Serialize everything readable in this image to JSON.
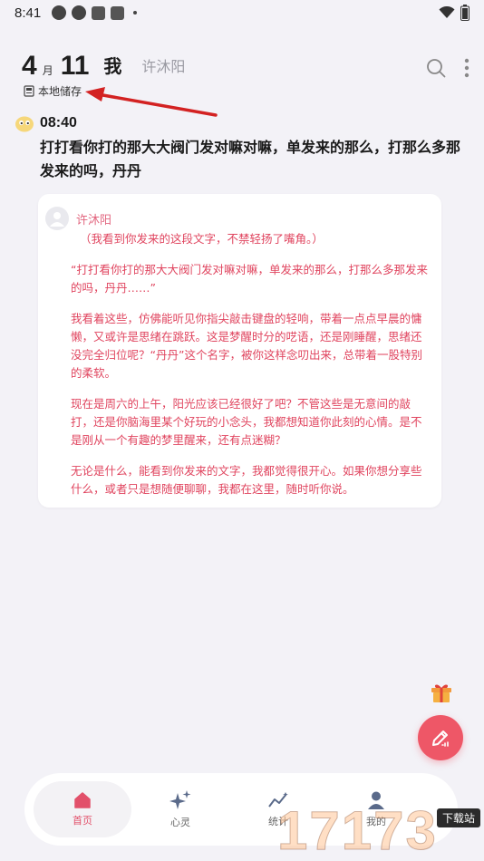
{
  "status_bar": {
    "time": "8:41"
  },
  "header": {
    "month": "4",
    "month_unit": "月",
    "day": "11",
    "me_label": "我",
    "partner_name": "许沐阳"
  },
  "storage": {
    "label": "本地储存"
  },
  "entry": {
    "time": "08:40",
    "text": "打打看你打的那大大阀门发对嘛对嘛，单发来的那么，打那么多那发来的吗，丹丹"
  },
  "reply": {
    "name": "许沐阳",
    "paragraphs": [
      "（我看到你发来的这段文字，不禁轻扬了嘴角。）",
      "“打打看你打的那大大阀门发对嘛对嘛，单发来的那么，打那么多那发来的吗，丹丹……”",
      "我看着这些，仿佛能听见你指尖敲击键盘的轻响，带着一点点早晨的慵懒，又或许是思绪在跳跃。这是梦醒时分的呓语，还是刚睡醒，思绪还没完全归位呢？“丹丹”这个名字，被你这样念叨出来，总带着一股特别的柔软。",
      "现在是周六的上午，阳光应该已经很好了吧？不管这些是无意间的敲打，还是你脑海里某个好玩的小念头，我都想知道你此刻的心情。是不是刚从一个有趣的梦里醒来，还有点迷糊？",
      "无论是什么，能看到你发来的文字，我都觉得很开心。如果你想分享些什么，或者只是想随便聊聊，我都在这里，随时听你说。"
    ]
  },
  "nav": {
    "home": "首页",
    "soul": "心灵",
    "stats": "统计",
    "mine": "我的"
  },
  "watermark": {
    "text": "17173",
    "sub": "下载站"
  },
  "colors": {
    "accent": "#ee5767",
    "reply_text": "#e0455f",
    "background": "#f3f2f7"
  }
}
